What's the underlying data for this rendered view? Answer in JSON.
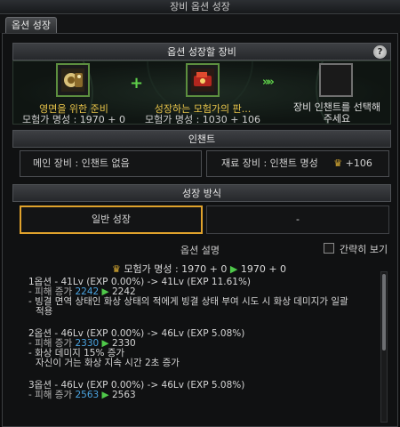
{
  "window": {
    "title": "장비 옵션 성장"
  },
  "tabs": [
    {
      "label": "옵션 성장"
    }
  ],
  "equip_section": {
    "title": "옵션 성장할 장비",
    "help_label": "?",
    "item1": {
      "name": "영면을 위한 준비",
      "stat": "모험가 명성 : 1970 + 0",
      "icon": "relic-item-icon"
    },
    "plus": "+",
    "item2": {
      "name": "성장하는 모험가의 판...",
      "stat": "모험가 명성 : 1030 + 106",
      "icon": "red-device-item-icon"
    },
    "arrows": "»»",
    "target": {
      "text_line1": "장비 인챈트를 선택해",
      "text_line2": "주세요"
    }
  },
  "enchant_section": {
    "title": "인챈트",
    "main_equip": "메인 장비 : 인챈트 없음",
    "material_equip": "재료 장비 : 인챈트 명성",
    "material_value": "+106"
  },
  "method_section": {
    "title": "성장 방식",
    "options": [
      "일반 성장",
      "-"
    ],
    "selected": 0
  },
  "description": {
    "title": "옵션 설명",
    "brief_label": "간략히 보기",
    "summary": {
      "label": "모험가 명성 : 1970 + 0",
      "arrow": "▶",
      "result": "1970 + 0"
    },
    "options": [
      {
        "header": "1옵션 - 41Lv (EXP 0.00%) -> 41Lv (EXP 11.61%)",
        "damage": {
          "label": "- 피해 증가",
          "from": "2242",
          "arrow": "▶",
          "to": "2242"
        },
        "effect1": "- 빙결 면역 상태인 화상 상태의 적에게 빙결 상태 부여 시도 시 화상 데미지가 일괄",
        "effect2": "적용"
      },
      {
        "header": "2옵션 - 46Lv (EXP 0.00%) -> 46Lv (EXP 5.08%)",
        "damage": {
          "label": "- 피해 증가",
          "from": "2330",
          "arrow": "▶",
          "to": "2330"
        },
        "effect1": "- 화상 데미지 15% 증가",
        "effect2": "자신이 거는 화상 지속 시간 2초 증가"
      },
      {
        "header": "3옵션 - 46Lv (EXP 0.00%) -> 46Lv (EXP 5.08%)",
        "damage": {
          "label": "- 피해 증가",
          "from": "2563",
          "arrow": "▶",
          "to": "2563"
        }
      }
    ]
  },
  "colors": {
    "accent_gold": "#e9c54a",
    "highlight_border": "#e0a22c",
    "green": "#4fc94a",
    "blue_value": "#4aa3e0"
  }
}
